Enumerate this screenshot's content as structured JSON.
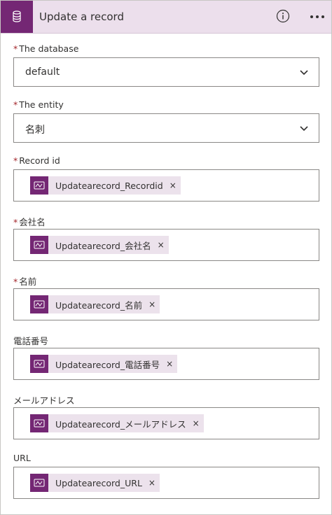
{
  "header": {
    "title": "Update a record",
    "accent": "#742774",
    "info_icon": "info-icon",
    "more_icon": "more-ellipsis-icon"
  },
  "required_marker": "*",
  "fields": {
    "database": {
      "label": "The database",
      "value": "default"
    },
    "entity": {
      "label": "The entity",
      "value": "名刺"
    },
    "record_id": {
      "label": "Record id",
      "token": "Updatearecord_Recordid"
    },
    "company": {
      "label": "会社名",
      "token": "Updatearecord_会社名"
    },
    "name": {
      "label": "名前",
      "token": "Updatearecord_名前"
    },
    "phone": {
      "label": "電話番号",
      "token": "Updatearecord_電話番号"
    },
    "email": {
      "label": "メールアドレス",
      "token": "Updatearecord_メールアドレス"
    },
    "url": {
      "label": "URL",
      "token": "Updatearecord_URL"
    }
  },
  "token_remove": "×"
}
